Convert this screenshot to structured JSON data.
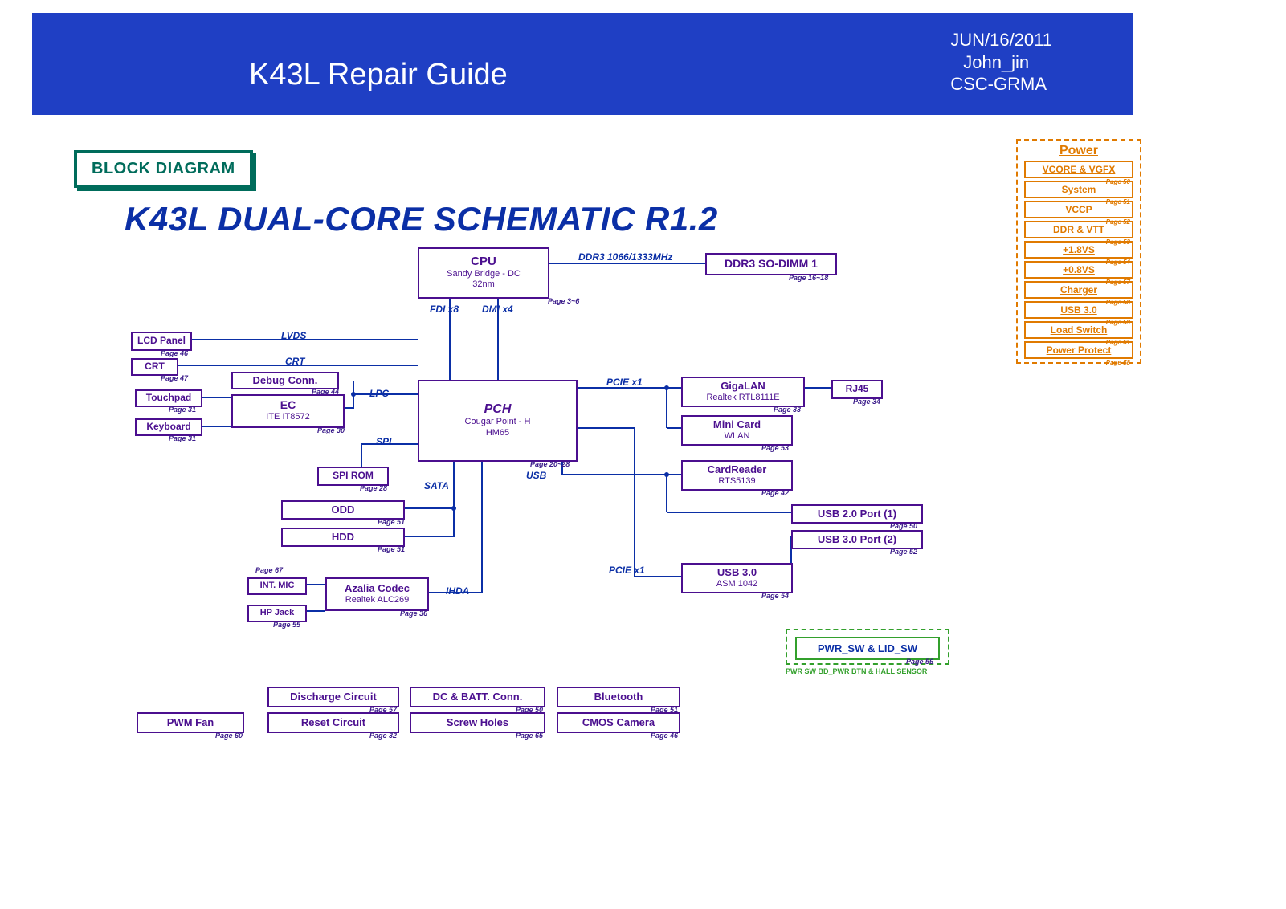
{
  "header": {
    "title": "K43L Repair Guide",
    "date": "JUN/16/2011",
    "author": "John_jin",
    "dept": "CSC-GRMA"
  },
  "badge": "BLOCK DIAGRAM",
  "schematic_title": "K43L DUAL-CORE SCHEMATIC R1.2",
  "power": {
    "title": "Power",
    "rows": [
      {
        "label": "VCORE & VGFX",
        "page": "Page 50"
      },
      {
        "label": "System",
        "page": "Page 51"
      },
      {
        "label": "VCCP",
        "page": "Page 52"
      },
      {
        "label": "DDR & VTT",
        "page": "Page 53"
      },
      {
        "label": "+1.8VS",
        "page": "Page 54"
      },
      {
        "label": "+0.8VS",
        "page": "Page 57"
      },
      {
        "label": "Charger",
        "page": "Page 58"
      },
      {
        "label": "USB 3.0",
        "page": "Page 59"
      },
      {
        "label": "Load Switch",
        "page": "Page 61"
      },
      {
        "label": "Power Protect",
        "page": "Page 58"
      }
    ]
  },
  "blocks": {
    "cpu": {
      "title": "CPU",
      "sub1": "Sandy Bridge - DC",
      "sub2": "32nm",
      "page": "Page 3~6"
    },
    "ddr": {
      "title": "DDR3 SO-DIMM 1",
      "page": "Page 16~18"
    },
    "pch": {
      "title": "PCH",
      "sub1": "Cougar Point - H",
      "sub2": "HM65",
      "page": "Page 20~28"
    },
    "lcd": {
      "title": "LCD Panel",
      "page": "Page 46"
    },
    "crt": {
      "title": "CRT",
      "page": "Page 47"
    },
    "touchpad": {
      "title": "Touchpad",
      "page": "Page 31"
    },
    "keyboard": {
      "title": "Keyboard",
      "page": "Page 31"
    },
    "debug": {
      "title": "Debug Conn.",
      "page": "Page 44"
    },
    "ec": {
      "title": "EC",
      "sub1": "ITE IT8572",
      "page": "Page 30"
    },
    "spirom": {
      "title": "SPI ROM",
      "page": "Page 28"
    },
    "odd": {
      "title": "ODD",
      "page": "Page 51"
    },
    "hdd": {
      "title": "HDD",
      "page": "Page 51"
    },
    "intmic": {
      "title": "INT. MIC",
      "page": "Page 67"
    },
    "hpjack": {
      "title": "HP Jack",
      "page": "Page 55"
    },
    "azalia": {
      "title": "Azalia Codec",
      "sub1": "Realtek ALC269",
      "page": "Page 36"
    },
    "gigalan": {
      "title": "GigaLAN",
      "sub1": "Realtek RTL8111E",
      "page": "Page 33"
    },
    "rj45": {
      "title": "RJ45",
      "page": "Page 34"
    },
    "minicard": {
      "title": "Mini Card",
      "sub1": "WLAN",
      "page": "Page 53"
    },
    "cardreader": {
      "title": "CardReader",
      "sub1": "RTS5139",
      "page": "Page 42"
    },
    "usb20": {
      "title": "USB 2.0 Port (1)",
      "page": "Page 50"
    },
    "usb30p": {
      "title": "USB 3.0 Port (2)",
      "page": "Page 52"
    },
    "usb30": {
      "title": "USB 3.0",
      "sub1": "ASM 1042",
      "page": "Page 54"
    },
    "pwmfan": {
      "title": "PWM Fan",
      "page": "Page 60"
    },
    "discharge": {
      "title": "Discharge Circuit",
      "page": "Page 57"
    },
    "reset": {
      "title": "Reset Circuit",
      "page": "Page 32"
    },
    "dcbatt": {
      "title": "DC & BATT. Conn.",
      "page": "Page 50"
    },
    "screw": {
      "title": "Screw Holes",
      "page": "Page 65"
    },
    "bluetooth": {
      "title": "Bluetooth",
      "page": "Page 51"
    },
    "cmoscam": {
      "title": "CMOS Camera",
      "page": "Page 46"
    }
  },
  "bus": {
    "ddr3": "DDR3  1066/1333MHz",
    "fdi": "FDI  x8",
    "dmi": "DMI  x4",
    "lvds": "LVDS",
    "crt": "CRT",
    "lpc": "LPC",
    "spi": "SPI",
    "sata": "SATA",
    "ihda": "IHDA",
    "pcie1": "PCIE  x1",
    "pcie2": "PCIE  x1",
    "usb": "USB"
  },
  "pwr_sw": {
    "label": "PWR_SW & LID_SW",
    "page": "Page 56",
    "note": "PWR SW BD_PWR BTN & HALL SENSOR"
  }
}
